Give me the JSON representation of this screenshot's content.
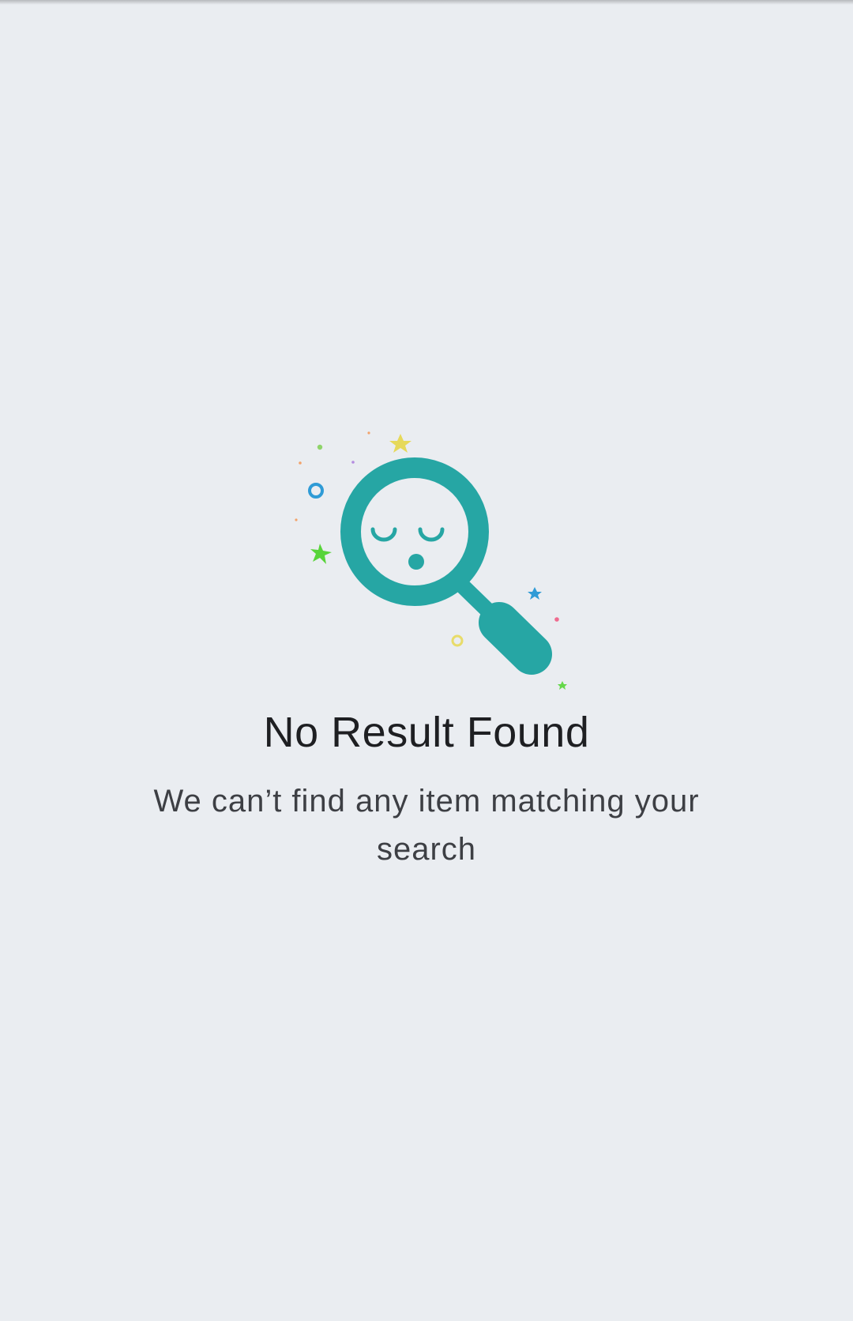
{
  "empty_state": {
    "illustration_icon": "magnifying-glass-sleepy-face-icon",
    "title": "No Result Found",
    "message": "We can’t find any item matching your search"
  },
  "colors": {
    "background": "#eaedf1",
    "accent": "#26a6a4",
    "title": "#1e1f22",
    "message": "#3d3f44"
  }
}
